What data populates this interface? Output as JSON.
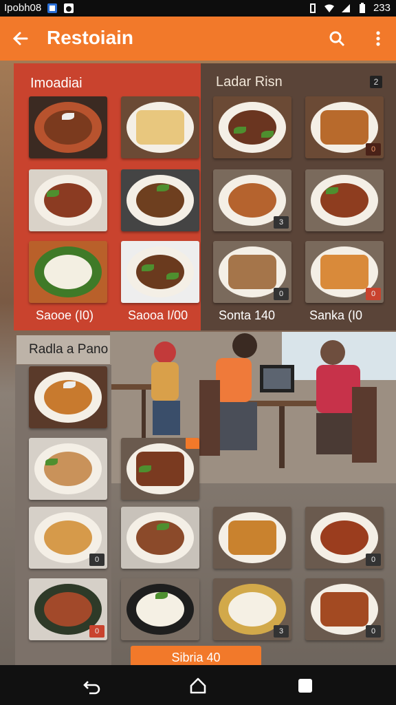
{
  "status_bar": {
    "carrier": "Ipobh08",
    "time": "233"
  },
  "app_bar": {
    "title": "Restoiain"
  },
  "sections": {
    "left_top": {
      "title": "Imoadiai"
    },
    "right_top": {
      "title": "Ladar Risn",
      "badge": "2"
    },
    "bottom": {
      "title": "Radla a Pano"
    }
  },
  "prices": [
    "Saooe (I0)",
    "Saooa I/00",
    "Sonta 140",
    "Sanka (I0"
  ],
  "tile_badges": {
    "r1c4": "0",
    "r2c3": "3",
    "r3c3": "0",
    "r3c4": "0",
    "b1c2": "",
    "b3c1": "0",
    "b3c4": "0",
    "b4c1": "0",
    "b4c3": "3",
    "b4c4": "0"
  },
  "bottom_button": "Sibria 40",
  "colors": {
    "accent": "#f2792a",
    "panel_red": "#c9432e",
    "panel_brown": "#5a4438"
  },
  "icons": [
    "back-arrow-icon",
    "search-icon",
    "more-vert-icon",
    "nav-back-icon",
    "nav-home-icon",
    "nav-recents-icon"
  ]
}
